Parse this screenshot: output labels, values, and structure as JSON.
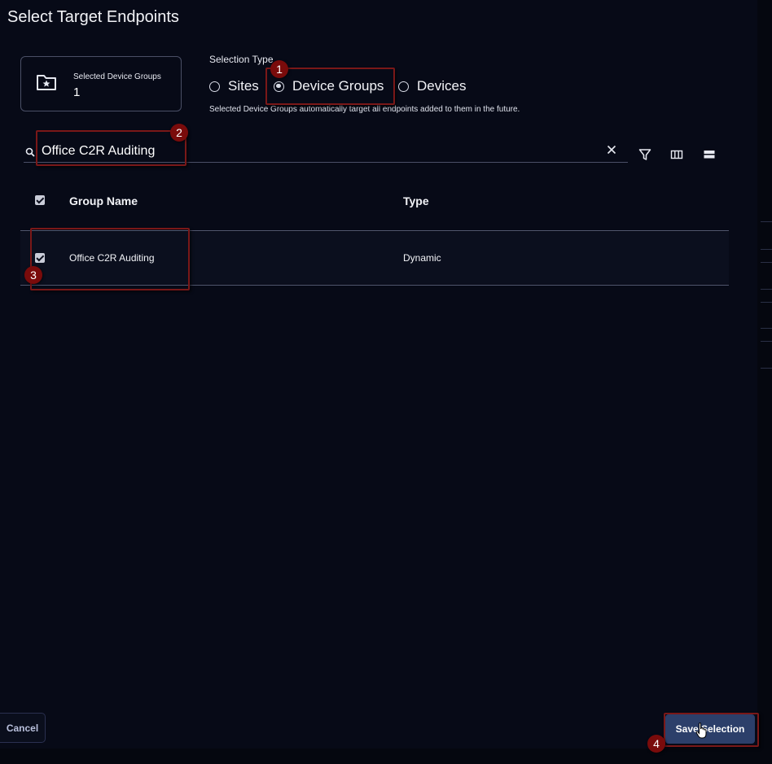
{
  "dialog": {
    "title": "Select Target Endpoints"
  },
  "summary_card": {
    "label": "Selected Device Groups",
    "count": "1",
    "icon": "folder-star-icon"
  },
  "selection_type": {
    "label": "Selection Type",
    "options": [
      {
        "label": "Sites",
        "selected": false
      },
      {
        "label": "Device Groups",
        "selected": true
      },
      {
        "label": "Devices",
        "selected": false
      }
    ],
    "hint": "Selected Device Groups automatically target all endpoints added to them in the future."
  },
  "search": {
    "value": "Office C2R Auditing",
    "icons": [
      "search-icon",
      "clear-icon"
    ]
  },
  "toolbar": {
    "icons": [
      "filter-icon",
      "columns-icon",
      "density-icon"
    ]
  },
  "table": {
    "columns": [
      "Group Name",
      "Type"
    ],
    "rows": [
      {
        "name": "Office C2R Auditing",
        "type": "Dynamic",
        "checked": true
      }
    ]
  },
  "footer": {
    "cancel_label": "Cancel",
    "save_label": "Save Selection"
  },
  "annotations": [
    "1",
    "2",
    "3",
    "4"
  ],
  "colors": {
    "background": "#070a17",
    "annotation": "#7a0b0b",
    "save_button": "#2c3f6a"
  }
}
